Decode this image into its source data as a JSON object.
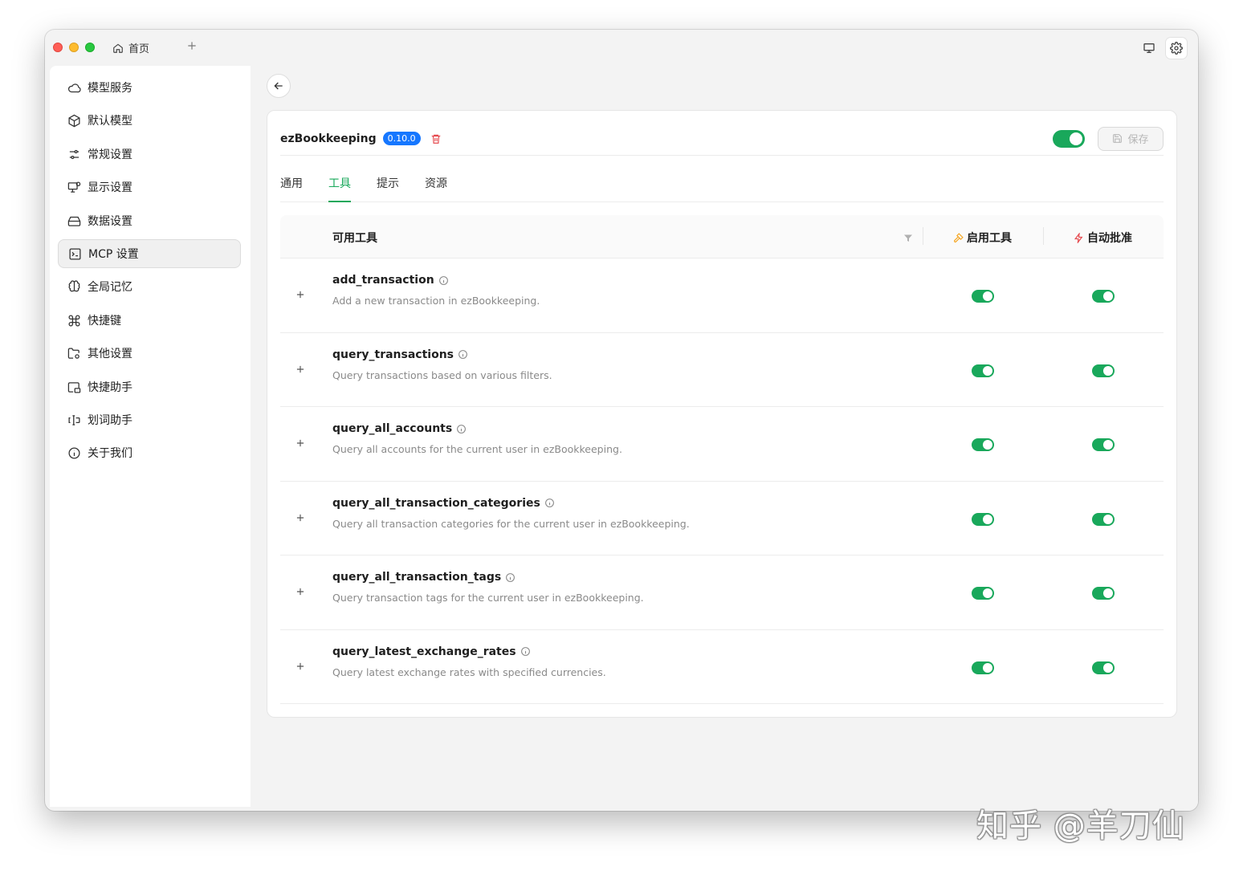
{
  "titlebar": {
    "home_tab_label": "首页",
    "add_tab_icon": "plus-icon",
    "right_icons": [
      "monitor-icon",
      "gear-icon"
    ]
  },
  "sidebar": {
    "items": [
      {
        "label": "模型服务",
        "icon": "cloud-icon"
      },
      {
        "label": "默认模型",
        "icon": "cube-icon"
      },
      {
        "label": "常规设置",
        "icon": "sliders-icon"
      },
      {
        "label": "显示设置",
        "icon": "monitor-settings-icon"
      },
      {
        "label": "数据设置",
        "icon": "hard-drive-icon"
      },
      {
        "label": "MCP 设置",
        "icon": "terminal-icon",
        "active": true
      },
      {
        "label": "全局记忆",
        "icon": "brain-icon"
      },
      {
        "label": "快捷键",
        "icon": "command-icon"
      },
      {
        "label": "其他设置",
        "icon": "folder-gear-icon"
      },
      {
        "label": "快捷助手",
        "icon": "app-window-icon"
      },
      {
        "label": "划词助手",
        "icon": "text-cursor-icon"
      },
      {
        "label": "关于我们",
        "icon": "info-icon"
      }
    ]
  },
  "server": {
    "name": "ezBookkeeping",
    "version": "0.10.0",
    "enabled": true,
    "save_label": "保存"
  },
  "tabs": [
    {
      "label": "通用",
      "active": false
    },
    {
      "label": "工具",
      "active": true
    },
    {
      "label": "提示",
      "active": false
    },
    {
      "label": "资源",
      "active": false
    }
  ],
  "table": {
    "col_tools": "可用工具",
    "col_enable": "启用工具",
    "col_auto_approve": "自动批准",
    "rows": [
      {
        "name": "add_transaction",
        "desc": "Add a new transaction in ezBookkeeping.",
        "enabled": true,
        "auto_approve": true
      },
      {
        "name": "query_transactions",
        "desc": "Query transactions based on various filters.",
        "enabled": true,
        "auto_approve": true
      },
      {
        "name": "query_all_accounts",
        "desc": "Query all accounts for the current user in ezBookkeeping.",
        "enabled": true,
        "auto_approve": true
      },
      {
        "name": "query_all_transaction_categories",
        "desc": "Query all transaction categories for the current user in ezBookkeeping.",
        "enabled": true,
        "auto_approve": true
      },
      {
        "name": "query_all_transaction_tags",
        "desc": "Query transaction tags for the current user in ezBookkeeping.",
        "enabled": true,
        "auto_approve": true
      },
      {
        "name": "query_latest_exchange_rates",
        "desc": "Query latest exchange rates with specified currencies.",
        "enabled": true,
        "auto_approve": true
      }
    ]
  },
  "watermark": "知乎 @羊刀仙",
  "colors": {
    "accent": "#19a85b",
    "badge": "#1677ff",
    "danger": "#e5484d"
  }
}
